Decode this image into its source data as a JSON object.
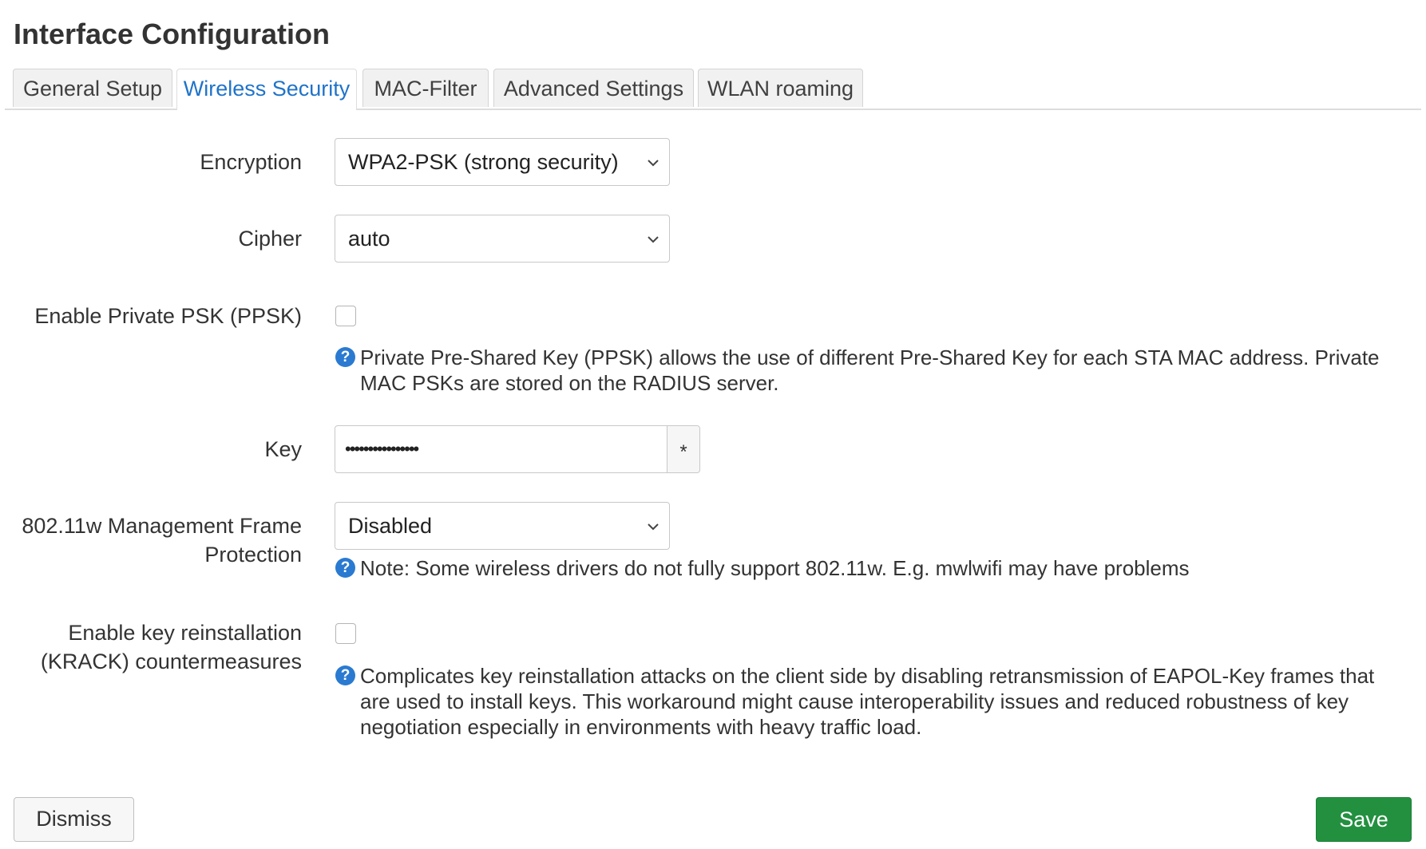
{
  "dialog": {
    "title": "Interface Configuration"
  },
  "tabs": [
    {
      "label": "General Setup",
      "active": false
    },
    {
      "label": "Wireless Security",
      "active": true
    },
    {
      "label": "MAC-Filter",
      "active": false
    },
    {
      "label": "Advanced Settings",
      "active": false
    },
    {
      "label": "WLAN roaming",
      "active": false
    }
  ],
  "fields": {
    "encryption": {
      "label": "Encryption",
      "value": "WPA2-PSK (strong security)"
    },
    "cipher": {
      "label": "Cipher",
      "value": "auto"
    },
    "ppsk": {
      "label": "Enable Private PSK (PPSK)",
      "checked": false,
      "help": "Private Pre-Shared Key (PPSK) allows the use of different Pre-Shared Key for each STA MAC address. Private MAC PSKs are stored on the RADIUS server."
    },
    "key": {
      "label": "Key",
      "value": "••••••••••••••••",
      "reveal_symbol": "*"
    },
    "mfp": {
      "label_line1": "802.11w Management Frame",
      "label_line2": "Protection",
      "value": "Disabled",
      "help": "Note: Some wireless drivers do not fully support 802.11w. E.g. mwlwifi may have problems"
    },
    "krack": {
      "label_line1": "Enable key reinstallation",
      "label_line2": "(KRACK) countermeasures",
      "checked": false,
      "help": "Complicates key reinstallation attacks on the client side by disabling retransmission of EAPOL-Key frames that are used to install keys. This workaround might cause interoperability issues and reduced robustness of key negotiation especially in environments with heavy traffic load."
    }
  },
  "help_icon_glyph": "?",
  "buttons": {
    "dismiss": "Dismiss",
    "save": "Save"
  },
  "colors": {
    "accent": "#1f73c9",
    "save": "#239040",
    "help_icon": "#2a7ad1"
  },
  "icons": {
    "select": "chevron-down-icon",
    "help": "question-circle-icon"
  }
}
